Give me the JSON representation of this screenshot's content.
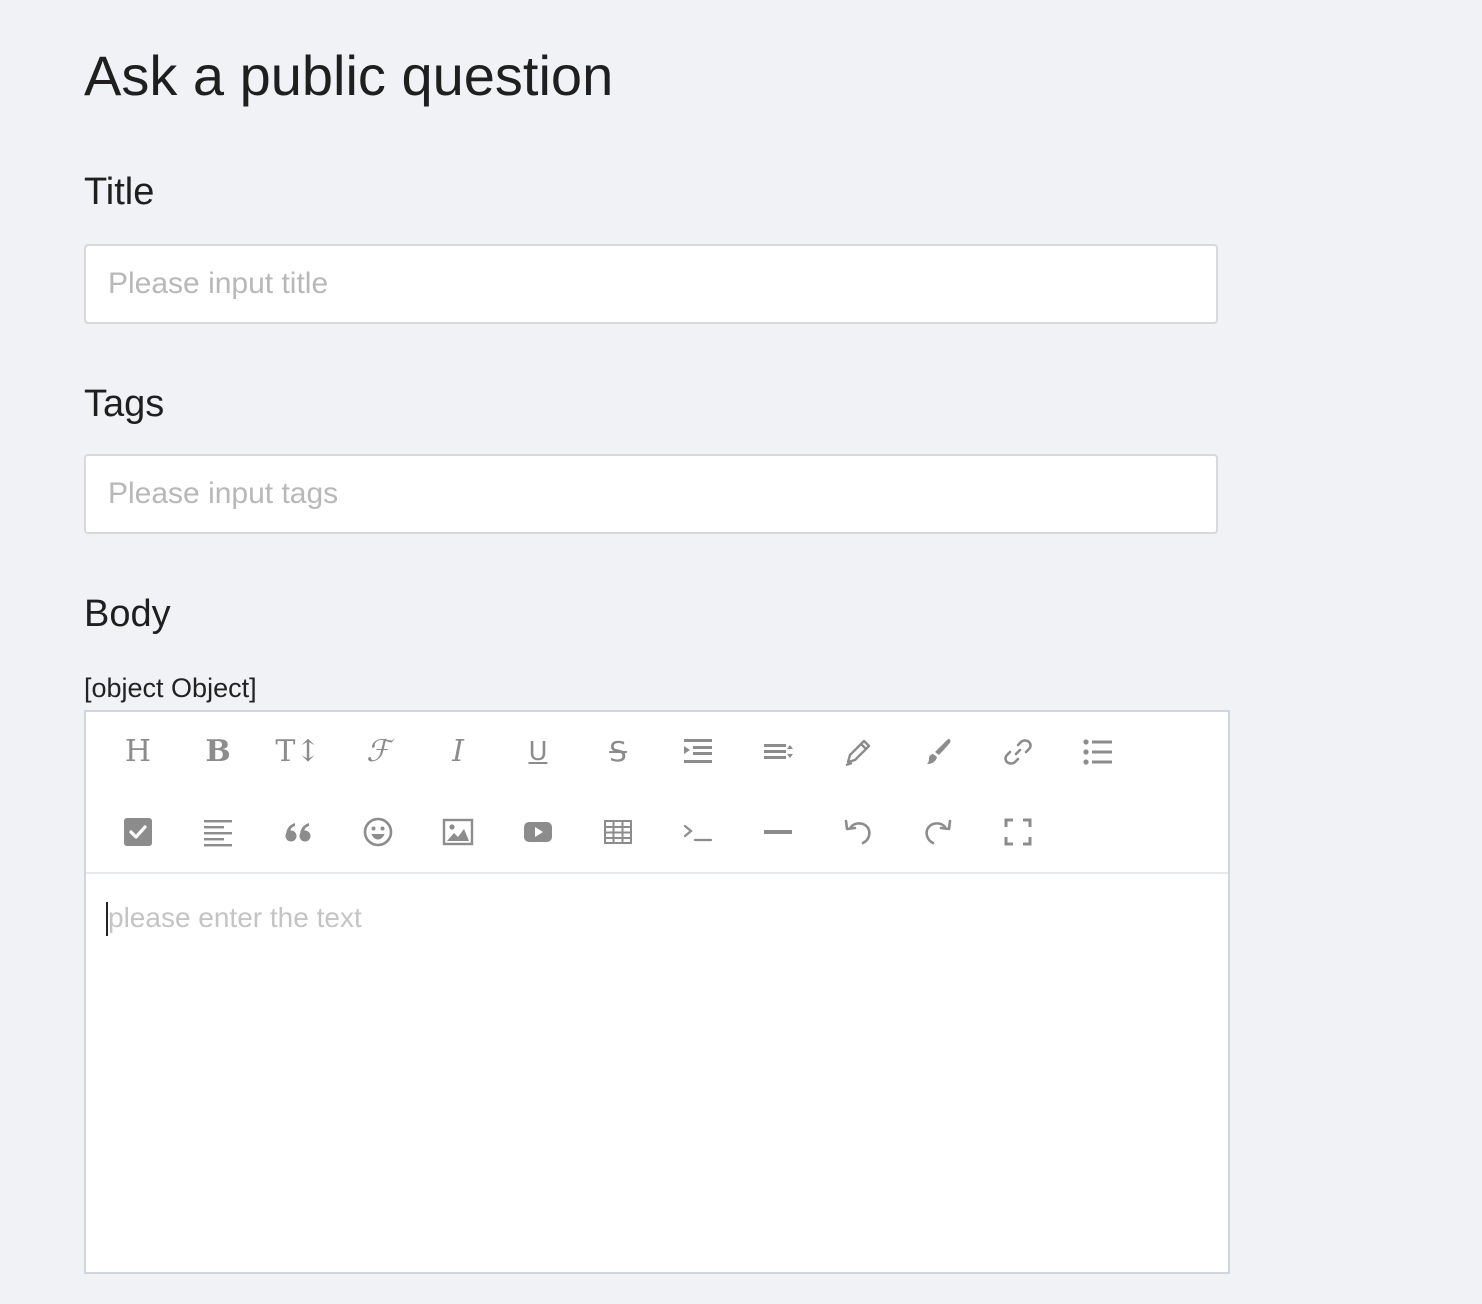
{
  "page": {
    "title": "Ask a public question"
  },
  "form": {
    "title_label": "Title",
    "title_placeholder": "Please input title",
    "tags_label": "Tags",
    "tags_placeholder": "Please input tags",
    "body_label": "Body",
    "body_hint": "[object Object]"
  },
  "editor": {
    "placeholder": "please enter the text",
    "toolbar_row1": [
      {
        "name": "heading",
        "icon": "heading-icon",
        "glyph": "H"
      },
      {
        "name": "bold",
        "icon": "bold-icon",
        "glyph": "B"
      },
      {
        "name": "font-size",
        "icon": "font-size-icon",
        "glyph": "T↕"
      },
      {
        "name": "font-family",
        "icon": "font-family-icon",
        "glyph": "ℱ"
      },
      {
        "name": "italic",
        "icon": "italic-icon",
        "glyph": "I"
      },
      {
        "name": "underline",
        "icon": "underline-icon",
        "glyph": "U"
      },
      {
        "name": "strikethrough",
        "icon": "strikethrough-icon",
        "glyph": "S"
      },
      {
        "name": "indent",
        "icon": "indent-icon"
      },
      {
        "name": "line-height",
        "icon": "line-height-icon"
      },
      {
        "name": "text-color",
        "icon": "pen-icon"
      },
      {
        "name": "background-color",
        "icon": "paint-brush-icon"
      },
      {
        "name": "link",
        "icon": "link-icon"
      },
      {
        "name": "bulleted-list",
        "icon": "list-icon"
      }
    ],
    "toolbar_row2": [
      {
        "name": "todo",
        "icon": "checkbox-icon"
      },
      {
        "name": "justify",
        "icon": "align-left-icon"
      },
      {
        "name": "quote",
        "icon": "quote-icon"
      },
      {
        "name": "emoticon",
        "icon": "emoji-icon"
      },
      {
        "name": "image",
        "icon": "image-icon"
      },
      {
        "name": "video",
        "icon": "video-icon"
      },
      {
        "name": "table",
        "icon": "table-icon"
      },
      {
        "name": "code",
        "icon": "terminal-icon"
      },
      {
        "name": "divider",
        "icon": "divider-icon"
      },
      {
        "name": "undo",
        "icon": "undo-icon"
      },
      {
        "name": "redo",
        "icon": "redo-icon"
      },
      {
        "name": "fullscreen",
        "icon": "fullscreen-icon"
      }
    ],
    "icon_color": "#8c8c8c"
  },
  "colors": {
    "background": "#f0f2f5",
    "input_border": "#d9d9d9",
    "editor_border": "#cfd6dc",
    "placeholder": "#b8b8b8"
  }
}
